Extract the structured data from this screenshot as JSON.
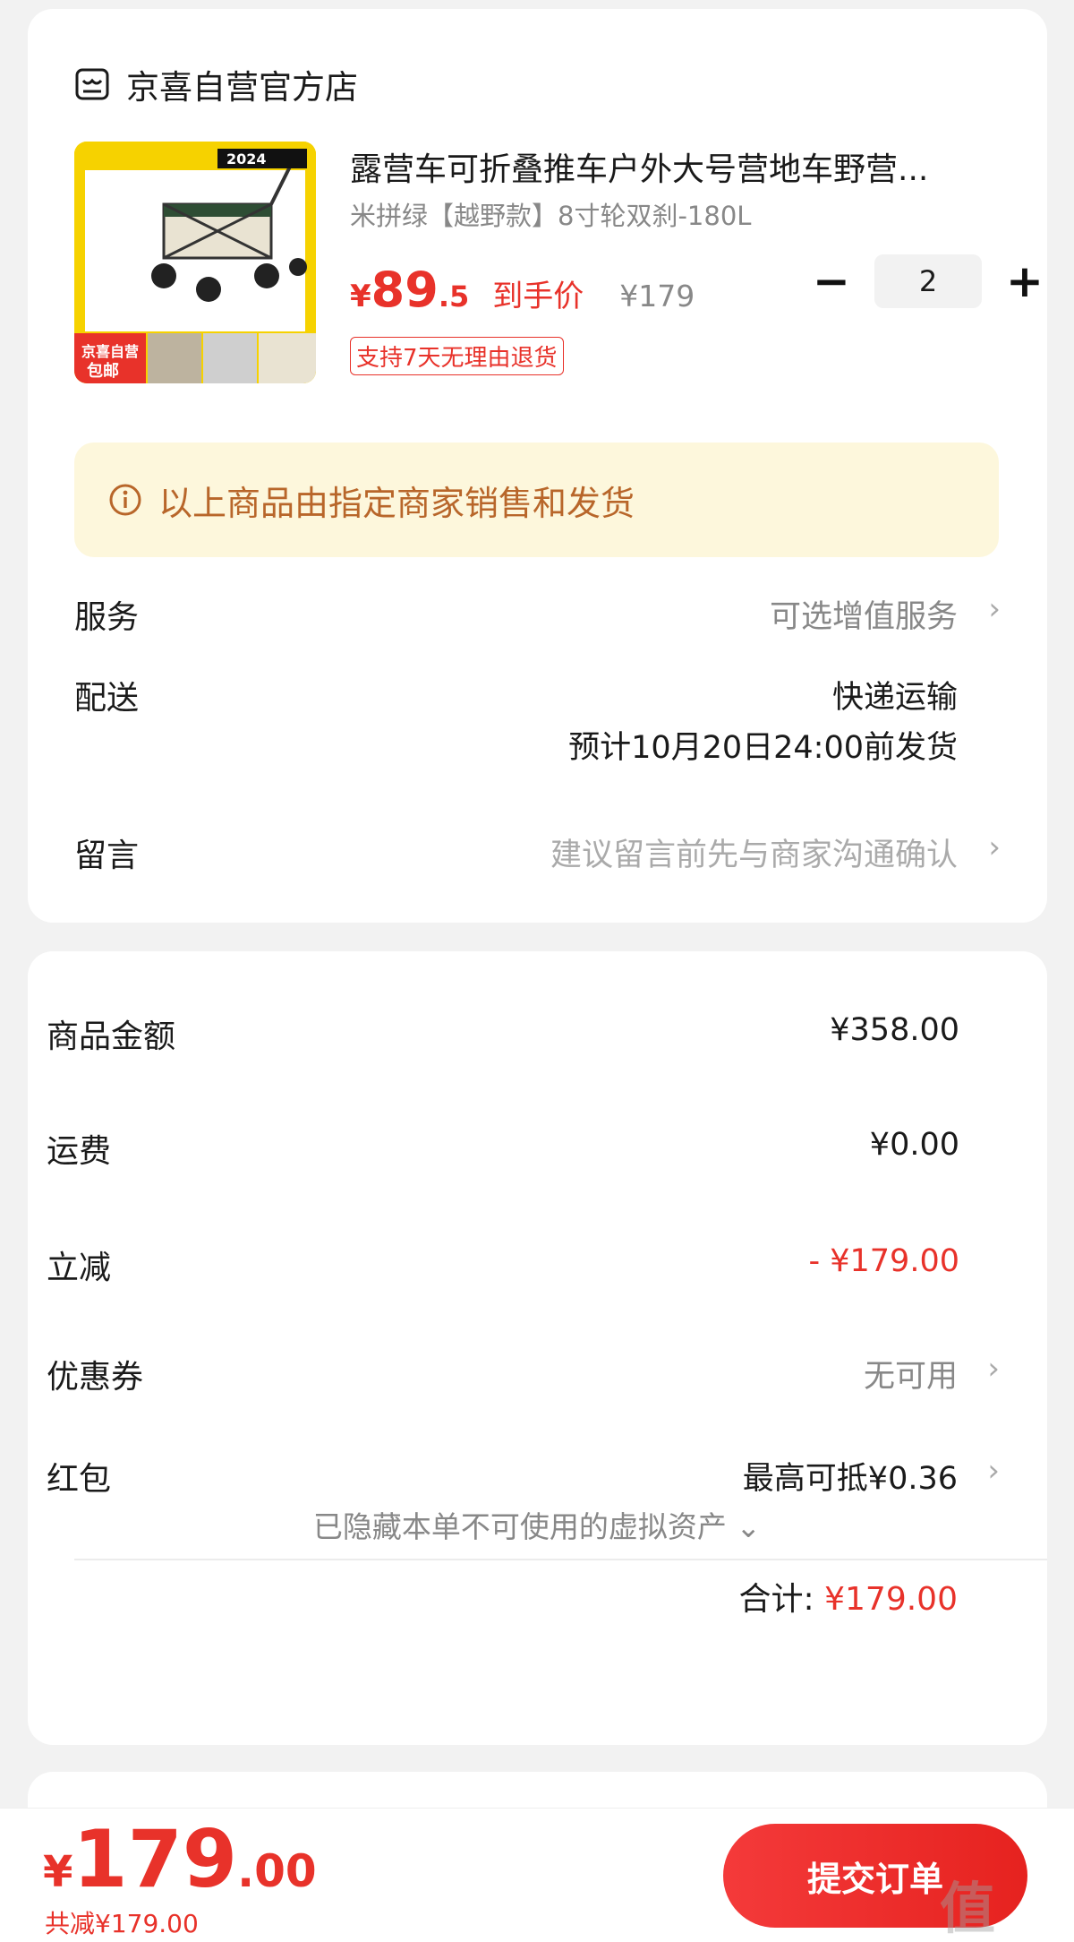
{
  "store": {
    "name": "京喜自营官方店"
  },
  "product": {
    "title": "露营车可折叠推车户外大号营地车野营...",
    "spec": "米拼绿【越野款】8寸轮双刹-180L",
    "price_symbol": "¥",
    "price_int": "89",
    "price_dec": ".5",
    "price_tag": "到手价",
    "original_price": "¥179",
    "quantity": "2",
    "minus": "−",
    "plus": "+",
    "return_tag": "支持7天无理由退货",
    "thumb_badge_top": "京喜自营",
    "thumb_badge_bottom": "包邮",
    "thumb_year": "2024"
  },
  "notice": {
    "text": "以上商品由指定商家销售和发货"
  },
  "service": {
    "label": "服务",
    "value": "可选增值服务"
  },
  "delivery": {
    "label": "配送",
    "method": "快递运输",
    "eta": "预计10月20日24:00前发货"
  },
  "message": {
    "label": "留言",
    "placeholder": "建议留言前先与商家沟通确认"
  },
  "summary": {
    "goods_label": "商品金额",
    "goods_value": "¥358.00",
    "shipping_label": "运费",
    "shipping_value": "¥0.00",
    "discount_label": "立减",
    "discount_value": "- ¥179.00",
    "coupon_label": "优惠券",
    "coupon_value": "无可用",
    "redpacket_label": "红包",
    "redpacket_value": "最高可抵¥0.36",
    "hidden_assets": "已隐藏本单不可使用的虚拟资产",
    "total_label": "合计:",
    "total_value": "¥179.00"
  },
  "footer": {
    "price_symbol": "¥",
    "price_int": "179",
    "price_dec": ".00",
    "saving": "共减¥179.00",
    "submit_label": "提交订单"
  },
  "colors": {
    "accent": "#e8322a",
    "notice_bg": "#fdf7dc",
    "notice_text": "#b8662a"
  }
}
